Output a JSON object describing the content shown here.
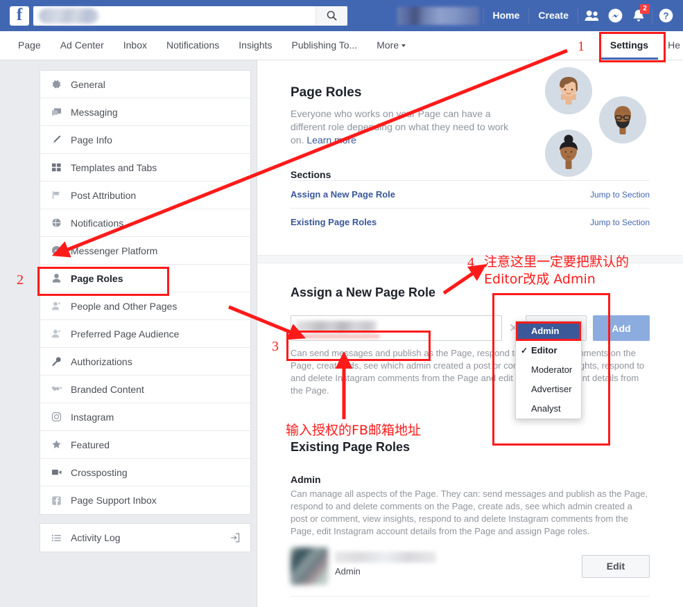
{
  "topbar": {
    "logo": "f",
    "search_placeholder": "",
    "search_value": "",
    "search_icon": "search-icon",
    "account_name": "",
    "links": [
      {
        "label": "Home",
        "name": "home-link"
      },
      {
        "label": "Create",
        "name": "create-link"
      }
    ],
    "icons": [
      {
        "name": "friend-requests-icon",
        "glyph": "people"
      },
      {
        "name": "messenger-icon",
        "glyph": "messenger"
      },
      {
        "name": "notifications-icon",
        "glyph": "bell",
        "badge": "2"
      },
      {
        "name": "help-icon",
        "glyph": "question"
      }
    ]
  },
  "tabbar": {
    "tabs": [
      {
        "label": "Page",
        "active": false
      },
      {
        "label": "Ad Center",
        "active": false
      },
      {
        "label": "Inbox",
        "active": false
      },
      {
        "label": "Notifications",
        "active": false
      },
      {
        "label": "Insights",
        "active": false
      },
      {
        "label": "Publishing To...",
        "active": false
      },
      {
        "label": "More",
        "active": false,
        "caret": true
      }
    ],
    "settings": "Settings",
    "help": "He"
  },
  "sidebar": {
    "items": [
      {
        "label": "General",
        "icon": "gear-icon",
        "selected": false
      },
      {
        "label": "Messaging",
        "icon": "chat-bubble-icon",
        "selected": false
      },
      {
        "label": "Page Info",
        "icon": "pencil-icon",
        "selected": false
      },
      {
        "label": "Templates and Tabs",
        "icon": "grid-icon",
        "selected": false
      },
      {
        "label": "Post Attribution",
        "icon": "flag-icon",
        "selected": false
      },
      {
        "label": "Notifications",
        "icon": "globe-icon",
        "selected": false
      },
      {
        "label": "Messenger Platform",
        "icon": "messenger-icon",
        "selected": false
      },
      {
        "label": "Page Roles",
        "icon": "person-icon",
        "selected": true
      },
      {
        "label": "People and Other Pages",
        "icon": "person-star-icon",
        "selected": false
      },
      {
        "label": "Preferred Page Audience",
        "icon": "person-star-icon",
        "selected": false
      },
      {
        "label": "Authorizations",
        "icon": "wrench-icon",
        "selected": false
      },
      {
        "label": "Branded Content",
        "icon": "handshake-icon",
        "selected": false
      },
      {
        "label": "Instagram",
        "icon": "instagram-icon",
        "selected": false
      },
      {
        "label": "Featured",
        "icon": "star-icon",
        "selected": false
      },
      {
        "label": "Crossposting",
        "icon": "video-icon",
        "selected": false
      },
      {
        "label": "Page Support Inbox",
        "icon": "facebook-icon",
        "selected": false
      }
    ],
    "activity_log": {
      "label": "Activity Log",
      "icon": "list-icon",
      "end_icon": "open-external-icon"
    }
  },
  "main": {
    "hero": {
      "title": "Page Roles",
      "description": "Everyone who works on your Page can have a different role depending on what they need to work on.",
      "learn_more": "Learn more"
    },
    "sections_heading": "Sections",
    "sections": [
      {
        "label": "Assign a New Page Role",
        "action": "Jump to Section"
      },
      {
        "label": "Existing Page Roles",
        "action": "Jump to Section"
      }
    ],
    "assign": {
      "heading": "Assign a New Page Role",
      "input_value": "",
      "input_placeholder": "",
      "clear_icon": "close-icon",
      "selected_role": "Editor",
      "add_label": "Add",
      "role_help": "Can send messages and publish as the Page, respond to and delete comments on the Page, create ads, see which admin created a post or comment, view insights, respond to and delete Instagram comments from the Page and edit Instagram account details from the Page."
    },
    "role_dropdown": {
      "options": [
        {
          "label": "Admin",
          "highlighted": true,
          "checked": false
        },
        {
          "label": "Editor",
          "highlighted": false,
          "checked": true
        },
        {
          "label": "Moderator",
          "highlighted": false,
          "checked": false
        },
        {
          "label": "Advertiser",
          "highlighted": false,
          "checked": false
        },
        {
          "label": "Analyst",
          "highlighted": false,
          "checked": false
        }
      ]
    },
    "existing": {
      "heading": "Existing Page Roles",
      "role_name": "Admin",
      "role_desc": "Can manage all aspects of the Page. They can: send messages and publish as the Page, respond to and delete comments on the Page, create ads, see which admin created a post or comment, view insights, respond to and delete Instagram comments from the Page, edit Instagram account details from the Page and assign Page roles.",
      "member_role": "Admin",
      "member_name": "",
      "edit_label": "Edit"
    }
  },
  "annotations": {
    "marker_1": "1",
    "marker_2": "2",
    "marker_3": "3",
    "marker_4": "4",
    "note_role_line1": "注意这里一定要把默认的",
    "note_role_line2": "Editor改成 Admin",
    "note_email": "输入授权的FB邮箱地址",
    "color": "#ff1a1a"
  }
}
